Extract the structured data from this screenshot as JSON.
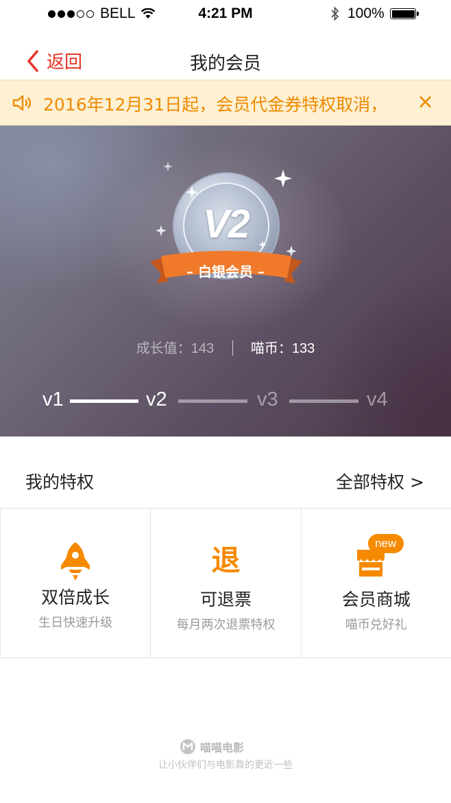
{
  "status_bar": {
    "carrier": "BELL",
    "time": "4:21 PM",
    "battery": "100%"
  },
  "nav": {
    "back_label": "返回",
    "title": "我的会员"
  },
  "notice": {
    "text": "2016年12月31日起，会员代金券特权取消，",
    "close": "×"
  },
  "member": {
    "level_badge": "V2",
    "level_name": "白银会员",
    "growth_label": "成长值：",
    "growth_value": "143",
    "coin_label": "喵币：",
    "coin_value": "133",
    "levels": [
      "v1",
      "v2",
      "v3",
      "v4"
    ],
    "current_level_index": 1
  },
  "privileges": {
    "title": "我的特权",
    "all_label": "全部特权 >",
    "items": [
      {
        "name": "双倍成长",
        "desc": "生日快速升级",
        "icon": "rocket-icon"
      },
      {
        "name": "可退票",
        "desc": "每月两次退票特权",
        "icon": "refund-icon",
        "icon_text": "退"
      },
      {
        "name": "会员商城",
        "desc": "喵币兑好礼",
        "icon": "shop-icon",
        "badge": "new"
      }
    ]
  },
  "footer": {
    "brand": "喵喵电影",
    "slogan": "让小伙伴们与电影靠的更近一些"
  },
  "colors": {
    "accent_red": "#e63226",
    "orange": "#f08a00",
    "notice_bg": "#fdf0d3"
  }
}
